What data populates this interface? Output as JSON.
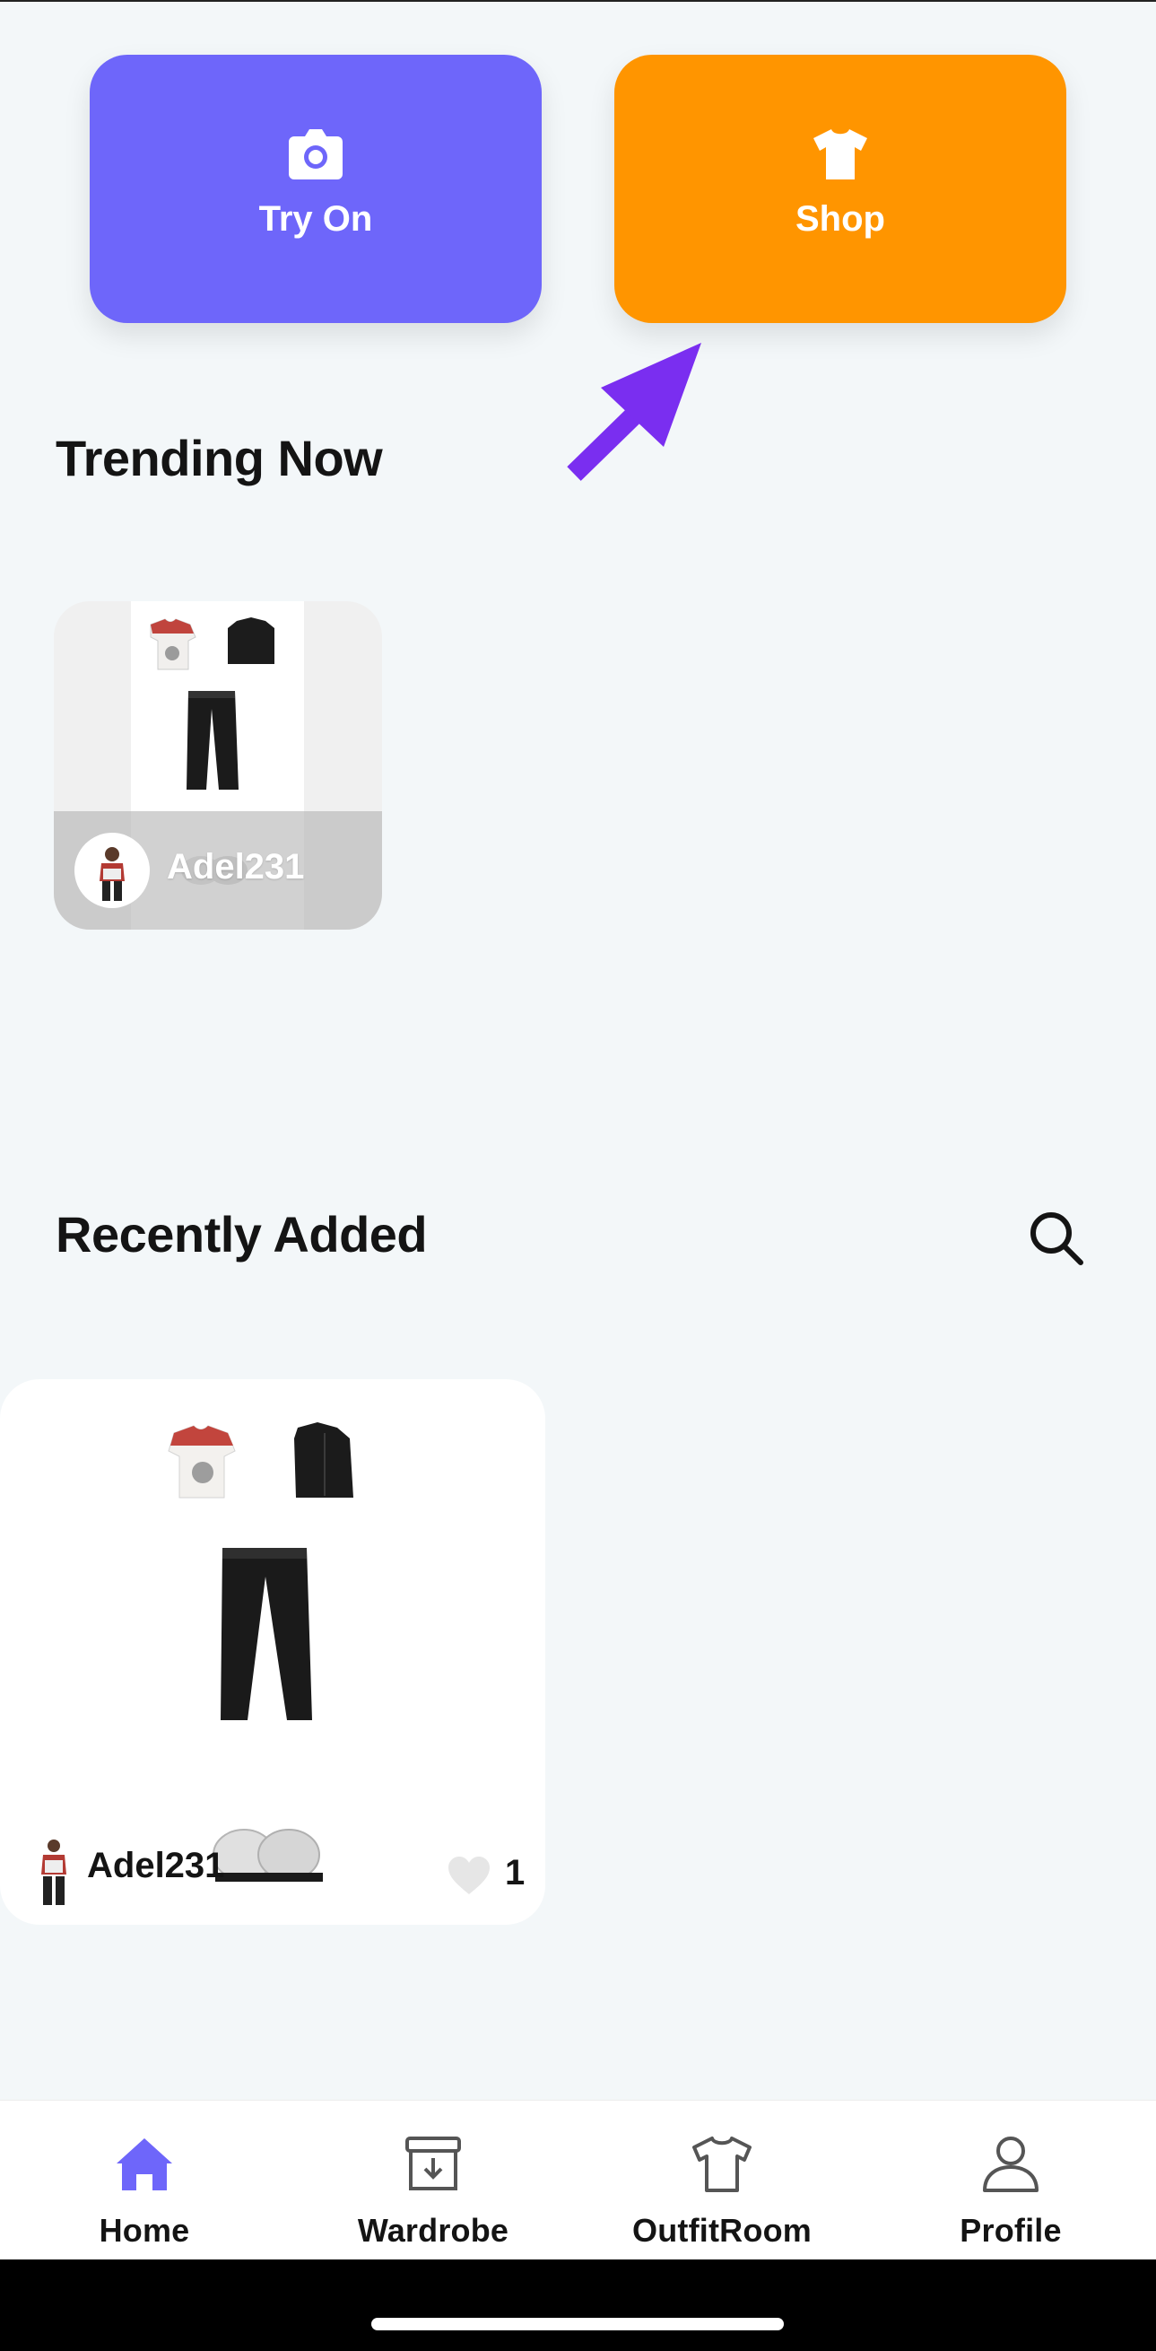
{
  "actions": {
    "try_on": {
      "label": "Try On",
      "icon": "camera-icon",
      "color": "#6e66fa"
    },
    "shop": {
      "label": "Shop",
      "icon": "tshirt-icon",
      "color": "#ff9500"
    }
  },
  "annotation": {
    "icon": "arrow-pointer-icon",
    "color": "#7a2ef0"
  },
  "trending": {
    "title": "Trending Now",
    "cards": [
      {
        "username": "Adel231"
      }
    ]
  },
  "recent": {
    "title": "Recently Added",
    "search_icon": "search-icon",
    "cards": [
      {
        "username": "Adel231",
        "likes": "1"
      }
    ]
  },
  "nav": {
    "items": [
      {
        "label": "Home",
        "icon": "home-icon",
        "active": true,
        "color": "#6e66fa"
      },
      {
        "label": "Wardrobe",
        "icon": "wardrobe-box-icon",
        "active": false
      },
      {
        "label": "OutfitRoom",
        "icon": "tshirt-outline-icon",
        "active": false
      },
      {
        "label": "Profile",
        "icon": "person-icon",
        "active": false
      }
    ]
  }
}
